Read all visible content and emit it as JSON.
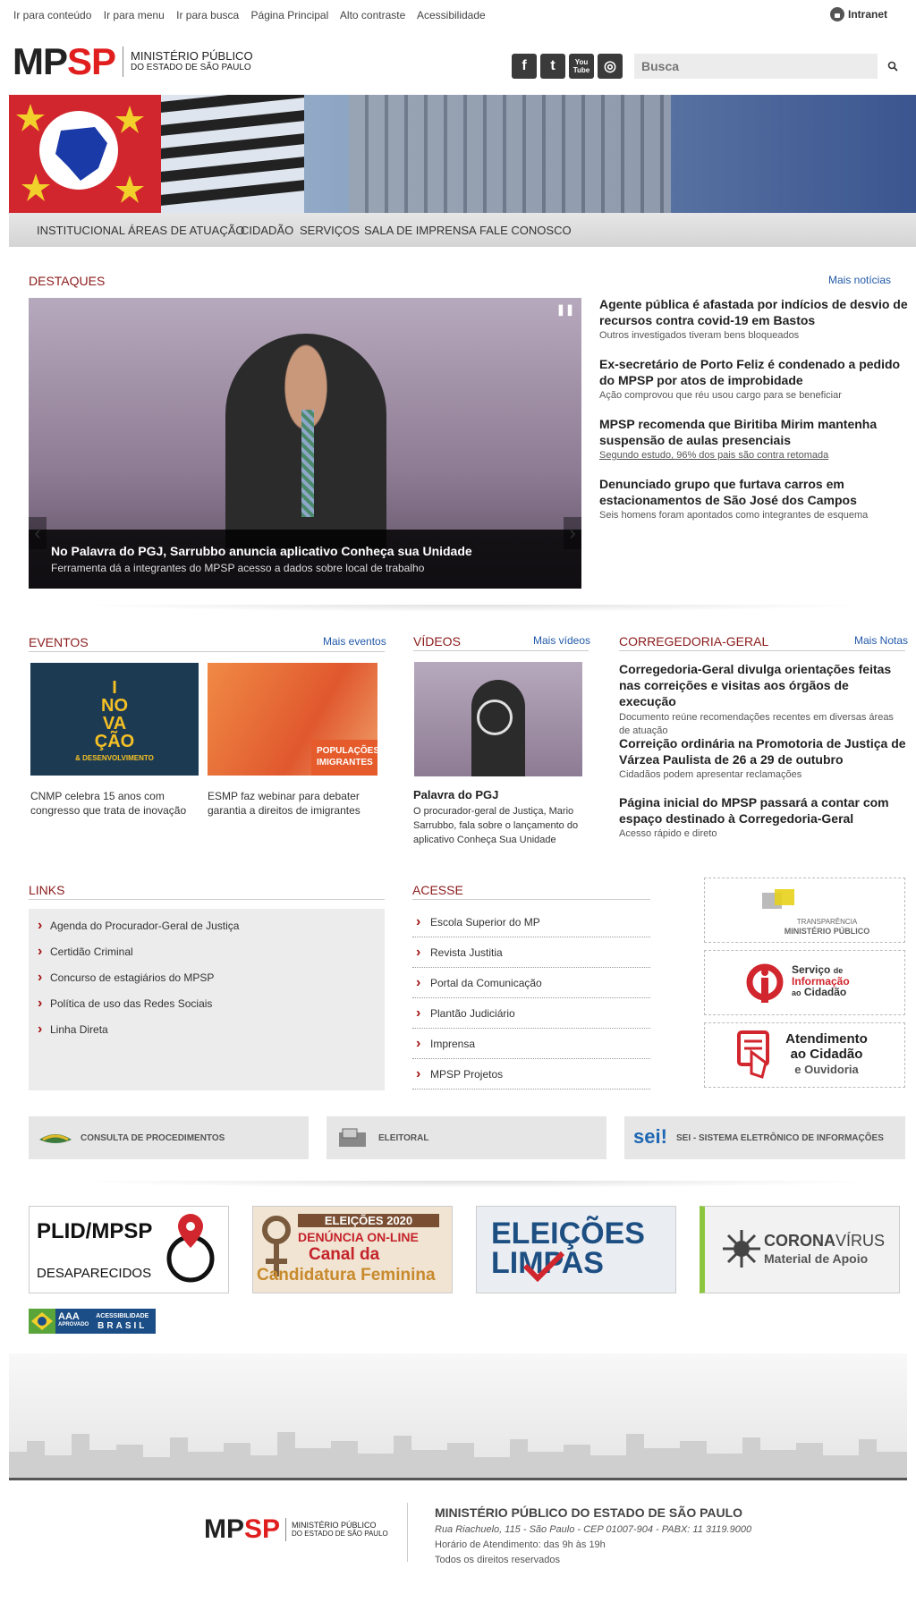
{
  "topbar": {
    "links": [
      "Ir para conteúdo",
      "Ir para menu",
      "Ir para busca",
      "Página Principal",
      "Alto contraste",
      "Acessibilidade"
    ],
    "intranet": "Intranet"
  },
  "logo": {
    "mp": "MP",
    "sp": "SP",
    "line1": "MINISTÉRIO PÚBLICO",
    "line2": "DO ESTADO DE SÃO PAULO"
  },
  "social": {
    "facebook": "f",
    "twitter": "t",
    "youtube": "You Tube",
    "instagram": "◎"
  },
  "search": {
    "placeholder": "Busca"
  },
  "nav": [
    "INSTITUCIONAL",
    "ÁREAS DE ATUAÇÃO",
    "CIDADÃO",
    "SERVIÇOS",
    "SALA DE IMPRENSA",
    "FALE CONOSCO"
  ],
  "destaques": {
    "title": "DESTAQUES",
    "more": "Mais notícias",
    "feature": {
      "title": "No Palavra do PGJ, Sarrubbo anuncia aplicativo Conheça sua Unidade",
      "subtitle": "Ferramenta dá a integrantes do MPSP acesso a dados sobre local de trabalho"
    },
    "news": [
      {
        "title": "Agente pública é afastada por indícios de desvio de recursos contra covid-19 em Bastos",
        "sub": "Outros investigados tiveram bens bloqueados"
      },
      {
        "title": "Ex-secretário de Porto Feliz é condenado a pedido do MPSP por atos de improbidade",
        "sub": "Ação comprovou que réu usou cargo para se beneficiar"
      },
      {
        "title": "MPSP recomenda que Biritiba Mirim mantenha suspensão de aulas presenciais",
        "sub": "Segundo estudo, 96% dos pais são contra retomada"
      },
      {
        "title": "Denunciado grupo que furtava carros em estacionamentos de São José dos Campos",
        "sub": "Seis homens foram apontados como integrantes de esquema"
      }
    ]
  },
  "eventos": {
    "title": "EVENTOS",
    "more": "Mais eventos",
    "items": [
      {
        "text": "CNMP celebra 15 anos com congresso que trata de inovação",
        "img_text": [
          "I",
          "NO",
          "VA",
          "ÇÃO",
          "& DESENVOLVIMENTO"
        ]
      },
      {
        "text": "ESMP faz webinar para debater garantia a direitos de imigrantes",
        "img_text": [
          "POPULAÇÕES",
          "IMIGRANTES"
        ]
      }
    ]
  },
  "videos": {
    "title": "VÍDEOS",
    "more": "Mais vídeos",
    "item_title": "Palavra do PGJ",
    "item_text": "O procurador-geral de Justiça, Mario Sarrubbo, fala sobre o lançamento do aplicativo Conheça Sua Unidade"
  },
  "corregedoria": {
    "title": "CORREGEDORIA-GERAL",
    "more": "Mais Notas",
    "news": [
      {
        "title": "Corregedoria-Geral divulga orientações feitas nas correições e visitas aos órgãos de execução",
        "sub": "Documento reúne recomendações recentes em diversas áreas de atuação"
      },
      {
        "title": "Correição ordinária na Promotoria de Justiça de Várzea Paulista de 26 a 29 de outubro",
        "sub": "Cidadãos podem apresentar reclamações"
      },
      {
        "title": "Página inicial do MPSP passará a contar com espaço destinado à Corregedoria-Geral",
        "sub": "Acesso rápido e direto"
      }
    ]
  },
  "links": {
    "title": "LINKS",
    "items": [
      "Agenda do Procurador-Geral de Justiça",
      "Certidão Criminal",
      "Concurso de estagiários do MPSP",
      "Política de uso das Redes Sociais",
      "Linha Direta"
    ]
  },
  "acesse": {
    "title": "ACESSE",
    "items": [
      "Escola Superior do MP",
      "Revista Justitia",
      "Portal da Comunicação",
      "Plantão Judiciário",
      "Imprensa",
      "MPSP Projetos"
    ]
  },
  "side_boxes": {
    "transparencia": [
      "TRANSPARÊNCIA",
      "MINISTÉRIO PÚBLICO"
    ],
    "sic": [
      "Serviço",
      "de",
      "Informação",
      "ao",
      "Cidadão"
    ],
    "atendimento": [
      "Atendimento",
      "ao Cidadão",
      "e Ouvidoria"
    ]
  },
  "tools": [
    "CONSULTA DE PROCEDIMENTOS",
    "ELEITORAL",
    "SEI - SISTEMA ELETRÔNICO DE INFORMAÇÕES"
  ],
  "sei_logo": "sei!",
  "banners": {
    "plid": [
      "PLID/MPSP",
      "DESAPARECIDOS"
    ],
    "eleicoes2020": [
      "ELEIÇÕES 2020",
      "DENÚNCIA ON-LINE",
      "Canal da",
      "Candidatura Feminina"
    ],
    "limpas": [
      "ELEIÇÕES",
      "LIMPAS"
    ],
    "corona": [
      "CORONA",
      "VÍRUS",
      "Material de Apoio"
    ]
  },
  "accessibility_badge": {
    "aaa": "AAA",
    "approved": "APROVADO",
    "line1": "ACESSIBILIDADE",
    "line2": "BRASIL"
  },
  "footer": {
    "name": "MINISTÉRIO PÚBLICO DO ESTADO DE SÃO PAULO",
    "address": "Rua Riachuelo, 115 - São Paulo - CEP 01007-904 - PABX: 11 3119.9000",
    "hours": "Horário de Atendimento: das 9h às 19h",
    "rights": "Todos os direitos reservados"
  },
  "colors": {
    "brand_red": "#e01e1e",
    "section_red": "#8b1a1a",
    "link_blue": "#2259a8",
    "nav_gray": "#dcdcdc"
  }
}
